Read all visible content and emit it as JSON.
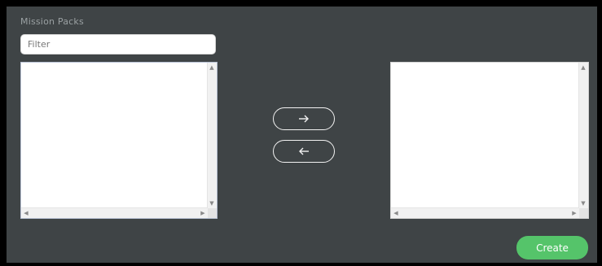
{
  "section": {
    "title": "Mission Packs"
  },
  "filter": {
    "placeholder": "Filter",
    "value": ""
  },
  "available_list": {
    "items": []
  },
  "selected_list": {
    "items": []
  },
  "transfer": {
    "add_icon": "arrow-right-icon",
    "remove_icon": "arrow-left-icon"
  },
  "actions": {
    "create_label": "Create"
  },
  "colors": {
    "background": "#3f4446",
    "create_button": "#55c46a",
    "outline_button": "#f2f2f2"
  }
}
